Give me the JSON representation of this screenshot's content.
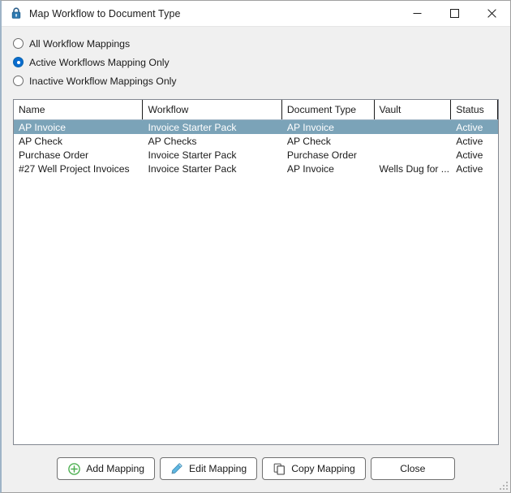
{
  "window": {
    "title": "Map Workflow to Document Type",
    "icon": "lock-icon",
    "minimize_label": "Minimize",
    "maximize_label": "Maximize",
    "close_label": "Close"
  },
  "filters": {
    "options": [
      {
        "label": "All Workflow Mappings",
        "selected": false
      },
      {
        "label": "Active Workflows Mapping Only",
        "selected": true
      },
      {
        "label": "Inactive Workflow Mappings Only",
        "selected": false
      }
    ]
  },
  "grid": {
    "columns": [
      "Name",
      "Workflow",
      "Document Type",
      "Vault",
      "Status"
    ],
    "rows": [
      {
        "name": "AP Invoice",
        "workflow": "Invoice Starter Pack",
        "document_type": "AP Invoice",
        "vault": "",
        "status": "Active",
        "selected": true
      },
      {
        "name": "AP Check",
        "workflow": "AP Checks",
        "document_type": "AP Check",
        "vault": "",
        "status": "Active",
        "selected": false
      },
      {
        "name": "Purchase Order",
        "workflow": "Invoice Starter Pack",
        "document_type": "Purchase Order",
        "vault": "",
        "status": "Active",
        "selected": false
      },
      {
        "name": "#27 Well Project Invoices",
        "workflow": "Invoice Starter Pack",
        "document_type": "AP Invoice",
        "vault": "Wells Dug for ...",
        "status": "Active",
        "selected": false
      }
    ]
  },
  "footer": {
    "add_label": "Add Mapping",
    "edit_label": "Edit Mapping",
    "copy_label": "Copy Mapping",
    "close_label": "Close"
  },
  "colors": {
    "selection": "#7ba3b8",
    "accent_radio": "#0a6cce",
    "add_icon": "#4caf50",
    "edit_icon": "#4aa8d8",
    "lock_icon": "#2c5f8a"
  }
}
